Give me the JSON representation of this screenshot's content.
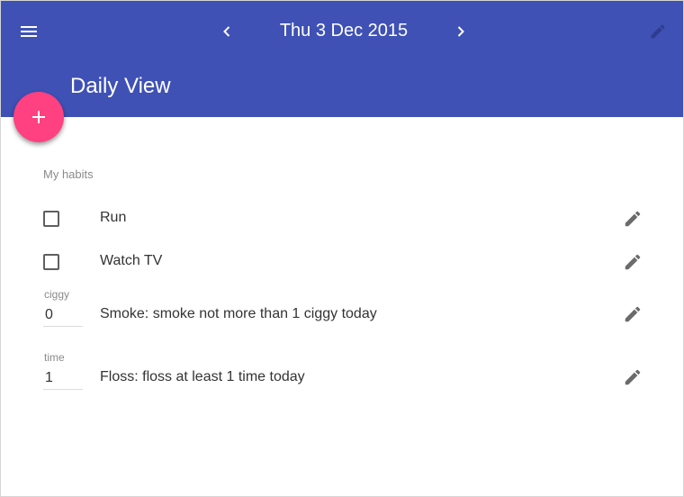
{
  "app_bar": {
    "date": "Thu 3 Dec 2015",
    "title": "Daily View",
    "icons": {
      "menu": "menu-icon",
      "prev": "chevron-left-icon",
      "next": "chevron-right-icon",
      "edit": "pencil-icon"
    },
    "color": "#3f51b5"
  },
  "fab": {
    "icon": "plus-icon",
    "color": "#ff4081"
  },
  "habits_section": {
    "label": "My habits"
  },
  "habits": [
    {
      "type": "checkbox",
      "text": "Run",
      "checked": false
    },
    {
      "type": "checkbox",
      "text": "Watch TV",
      "checked": false
    },
    {
      "type": "counter",
      "unit_label": "ciggy",
      "value": "0",
      "text": "Smoke: smoke not more than 1 ciggy today"
    },
    {
      "type": "counter",
      "unit_label": "time",
      "value": "1",
      "text": "Floss: floss at least 1 time today"
    }
  ]
}
